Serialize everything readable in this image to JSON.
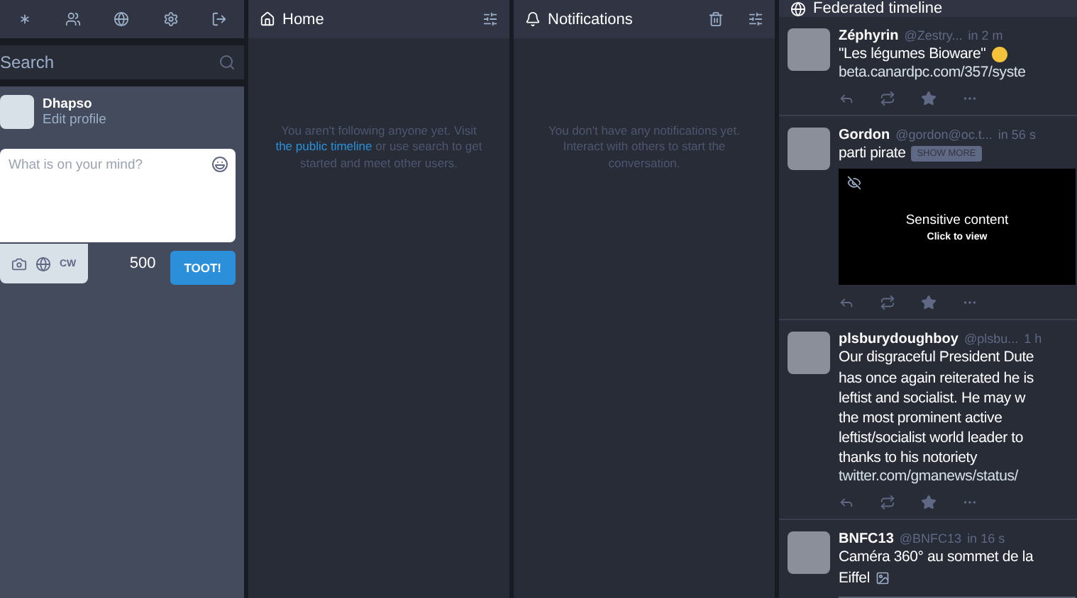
{
  "search": {
    "placeholder": "Search"
  },
  "account": {
    "name": "Dhapso",
    "link": "Edit profile"
  },
  "compose": {
    "placeholder": "What is on your mind?",
    "cw": "CW",
    "counter": "500",
    "submit": "TOOT!"
  },
  "columns": [
    {
      "title": "Home",
      "kind": "home",
      "empty": [
        {
          "text": "You aren't following anyone yet. Visit "
        },
        {
          "text": "the public timeline",
          "link": true
        },
        {
          "text": " or use search to get started and meet other users."
        }
      ]
    },
    {
      "title": "Notifications",
      "kind": "notifications",
      "empty": [
        {
          "text": "You don't have any notifications yet. Interact with others to start the conversation."
        }
      ]
    }
  ],
  "federated": {
    "title": "Federated timeline",
    "statuses": [
      {
        "name": "Zéphyrin",
        "handle": "@Zestry...",
        "time": "in 2 m",
        "lines": [
          "\"Les légumes Bioware\""
        ],
        "emoji": true,
        "link": "beta.canardpc.com/357/syste"
      },
      {
        "name": "Gordon",
        "handle": "@gordon@oc.t...",
        "time": "in 56 s",
        "lines": [
          "parti pirate"
        ],
        "spoiler": "SHOW MORE",
        "sensitive": {
          "title": "Sensitive content",
          "hint": "Click to view"
        }
      },
      {
        "name": "plsburydoughboy",
        "handle": "@plsbu...",
        "time": "1 h",
        "lines": [
          "Our disgraceful President Dute",
          "has once again reiterated he is",
          "leftist and socialist. He may w",
          "the most prominent active",
          "leftist/socialist world leader to",
          "thanks to his notoriety"
        ],
        "link": "twitter.com/gmanews/status/"
      },
      {
        "name": "BNFC13",
        "handle": "@BNFC13",
        "time": "in 16 s",
        "lines": [
          "Caméra 360° au sommet de la",
          "Eiffel"
        ],
        "media": true
      }
    ]
  }
}
